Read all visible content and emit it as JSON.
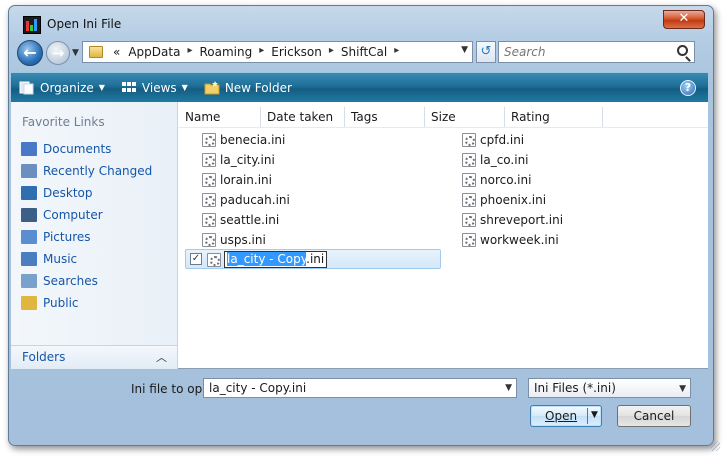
{
  "window": {
    "title": "Open Ini File",
    "close_glyph": "✕"
  },
  "nav": {
    "back_glyph": "←",
    "forward_glyph": "→",
    "refresh_glyph": "↺"
  },
  "address": {
    "crumbs": [
      "«",
      "AppData",
      "Roaming",
      "Erickson",
      "ShiftCal"
    ],
    "separator": "▸"
  },
  "search": {
    "placeholder": "Search"
  },
  "toolbar": {
    "organize": "Organize",
    "views": "Views",
    "new_folder": "New Folder",
    "help": "?"
  },
  "left_pane": {
    "favorite_links_header": "Favorite Links",
    "items": [
      {
        "label": "Documents",
        "icon": "documents-icon",
        "color": "#4a78c8"
      },
      {
        "label": "Recently Changed",
        "icon": "recently-changed-icon",
        "color": "#6b8fbf"
      },
      {
        "label": "Desktop",
        "icon": "desktop-icon",
        "color": "#2f6fb0"
      },
      {
        "label": "Computer",
        "icon": "computer-icon",
        "color": "#3c5f88"
      },
      {
        "label": "Pictures",
        "icon": "pictures-icon",
        "color": "#5a8ed0"
      },
      {
        "label": "Music",
        "icon": "music-icon",
        "color": "#4a7ec0"
      },
      {
        "label": "Searches",
        "icon": "searches-icon",
        "color": "#7aa0cc"
      },
      {
        "label": "Public",
        "icon": "public-folder-icon",
        "color": "#e0b641"
      }
    ],
    "folders_label": "Folders"
  },
  "columns": [
    "Name",
    "Date taken",
    "Tags",
    "Size",
    "Rating"
  ],
  "files_col1": [
    "benecia.ini",
    "la_city.ini",
    "lorain.ini",
    "paducah.ini",
    "seattle.ini",
    "usps.ini"
  ],
  "files_col2": [
    "cpfd.ini",
    "la_co.ini",
    "norco.ini",
    "phoenix.ini",
    "shreveport.ini",
    "workweek.ini"
  ],
  "renaming": {
    "selected_part": "la_city - Copy",
    "extension": ".ini",
    "checked_glyph": "✓"
  },
  "bottom": {
    "file_label": "Ini file to open:",
    "file_value": "la_city - Copy.ini",
    "filter_value": "Ini Files (*.ini)",
    "open_label": "Open",
    "cancel_label": "Cancel"
  },
  "colors": {
    "toolbar": "#1e6f98",
    "link": "#1556a8",
    "selection": "#3399ff"
  }
}
